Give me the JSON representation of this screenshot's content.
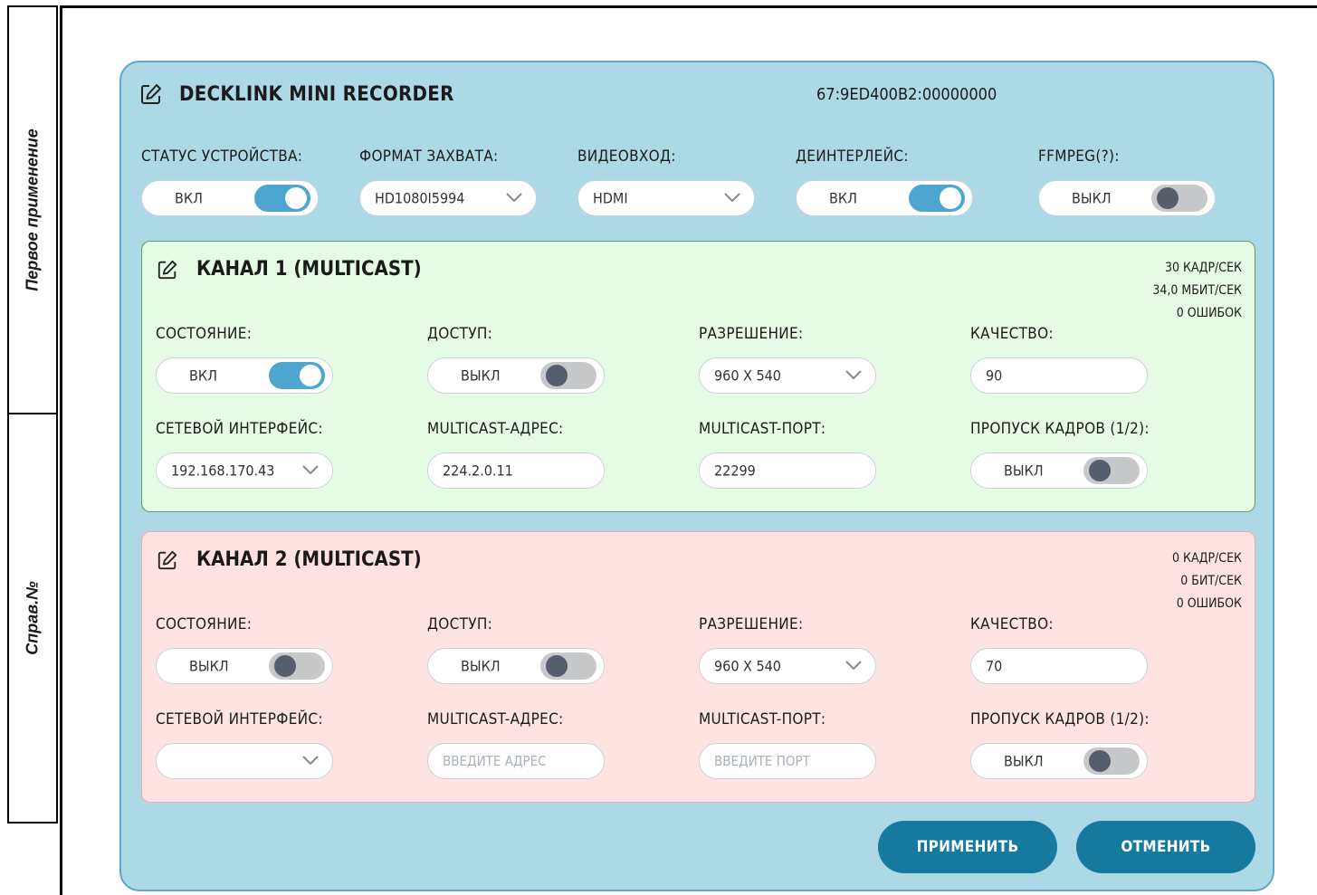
{
  "sidebar": {
    "top_label": "Первое применение",
    "bottom_label": "Справ.№"
  },
  "device": {
    "title": "DECKLINK MINI RECORDER",
    "id": "67:9ED400B2:00000000",
    "status": {
      "label": "СТАТУС УСТРОЙСТВА:",
      "value": "ВКЛ",
      "on": true
    },
    "capture_format": {
      "label": "ФОРМАТ ЗАХВАТА:",
      "value": "HD1080I5994"
    },
    "video_input": {
      "label": "ВИДЕОВХОД:",
      "value": "HDMI"
    },
    "deinterlace": {
      "label": "ДЕИНТЕРЛЕЙС:",
      "value": "ВКЛ",
      "on": true
    },
    "ffmpeg": {
      "label": "FFMPEG(?):",
      "value": "ВЫКЛ",
      "on": false
    }
  },
  "channels": [
    {
      "title": "КАНАЛ 1 (MULTICAST)",
      "stats": [
        "30 КАДР/СЕК",
        "34,0 МБИТ/СЕК",
        "0 ОШИБОК"
      ],
      "state": {
        "label": "СОСТОЯНИЕ:",
        "value": "ВКЛ",
        "on": true
      },
      "access": {
        "label": "ДОСТУП:",
        "value": "ВЫКЛ",
        "on": false
      },
      "resolution": {
        "label": "РАЗРЕШЕНИЕ:",
        "value": "960 X 540"
      },
      "quality": {
        "label": "КАЧЕСТВО:",
        "value": "90"
      },
      "interface": {
        "label": "СЕТЕВОЙ ИНТЕРФЕЙС:",
        "value": "192.168.170.43"
      },
      "address": {
        "label": "MULTICAST-АДРЕС:",
        "value": "224.2.0.11",
        "placeholder": "ВВЕДИТЕ АДРЕС"
      },
      "port": {
        "label": "MULTICAST-ПОРТ:",
        "value": "22299",
        "placeholder": "ВВЕДИТЕ ПОРТ"
      },
      "frame_skip": {
        "label": "ПРОПУСК КАДРОВ (1/2):",
        "value": "ВЫКЛ",
        "on": false
      }
    },
    {
      "title": "КАНАЛ 2 (MULTICAST)",
      "stats": [
        "0 КАДР/СЕК",
        "0 БИТ/СЕК",
        "0 ОШИБОК"
      ],
      "state": {
        "label": "СОСТОЯНИЕ:",
        "value": "ВЫКЛ",
        "on": false
      },
      "access": {
        "label": "ДОСТУП:",
        "value": "ВЫКЛ",
        "on": false
      },
      "resolution": {
        "label": "РАЗРЕШЕНИЕ:",
        "value": "960 X 540"
      },
      "quality": {
        "label": "КАЧЕСТВО:",
        "value": "70"
      },
      "interface": {
        "label": "СЕТЕВОЙ ИНТЕРФЕЙС:",
        "value": ""
      },
      "address": {
        "label": "MULTICAST-АДРЕС:",
        "value": "",
        "placeholder": "ВВЕДИТЕ АДРЕС"
      },
      "port": {
        "label": "MULTICAST-ПОРТ:",
        "value": "",
        "placeholder": "ВВЕДИТЕ ПОРТ"
      },
      "frame_skip": {
        "label": "ПРОПУСК КАДРОВ (1/2):",
        "value": "ВЫКЛ",
        "on": false
      }
    }
  ],
  "buttons": {
    "apply": "ПРИМЕНИТЬ",
    "cancel": "ОТМЕНИТЬ"
  },
  "colors": {
    "panel": "#add8e6",
    "channel_ok": "#e6fbe6",
    "channel_err": "#ffe3e3",
    "toggle_on": "#4da6cf",
    "button": "#167a9f"
  }
}
